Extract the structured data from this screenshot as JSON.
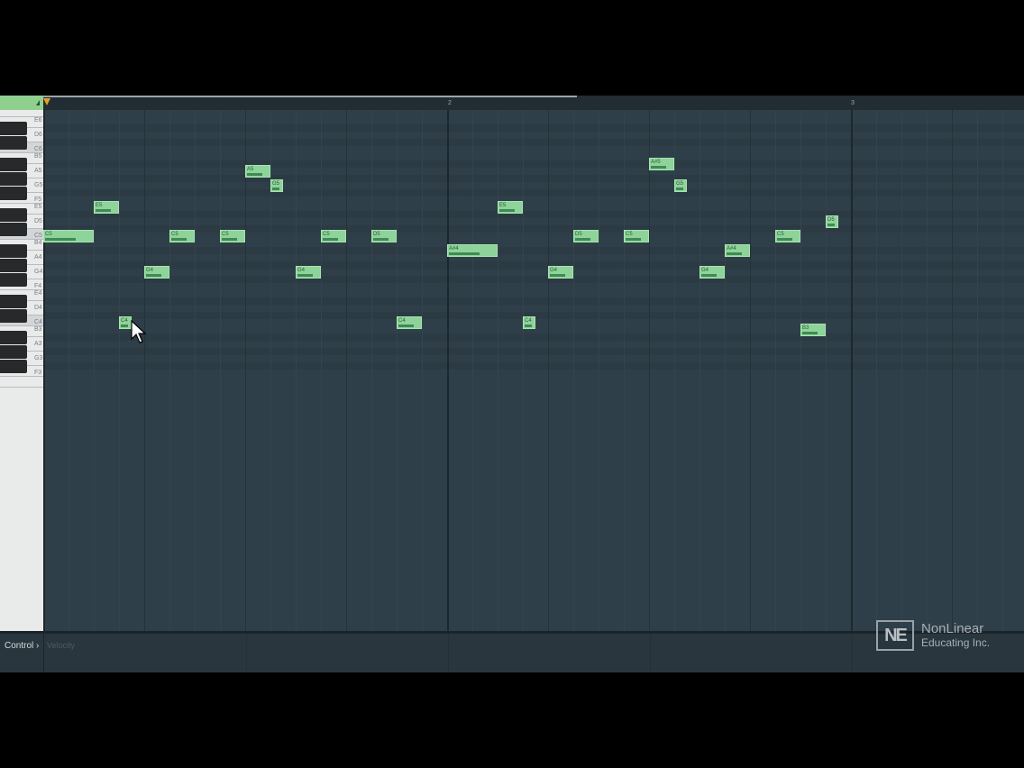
{
  "app": {
    "ruler_bars": [
      "2",
      "3"
    ],
    "accent_color": "#8ed39a",
    "playhead_color": "#e2a12a"
  },
  "keyboard": {
    "labels": [
      "E6",
      "D6",
      "C6",
      "B5",
      "A5",
      "G5",
      "F5",
      "E5",
      "D5",
      "C5",
      "B4",
      "A4",
      "G4",
      "F4",
      "E4",
      "D4",
      "C4",
      "B3",
      "A3",
      "G3",
      "F3"
    ]
  },
  "notes": [
    {
      "label": "C5"
    },
    {
      "label": "E5"
    },
    {
      "label": "C4"
    },
    {
      "label": "G4"
    },
    {
      "label": "C5"
    },
    {
      "label": "C5"
    },
    {
      "label": "A5"
    },
    {
      "label": "G5"
    },
    {
      "label": "G4"
    },
    {
      "label": "C5"
    },
    {
      "label": "D5"
    },
    {
      "label": "C4"
    },
    {
      "label": "A#4"
    },
    {
      "label": "E5"
    },
    {
      "label": "C4"
    },
    {
      "label": "G4"
    },
    {
      "label": "D5"
    },
    {
      "label": "C5"
    },
    {
      "label": "A#5"
    },
    {
      "label": "G5"
    },
    {
      "label": "G4"
    },
    {
      "label": "A#4"
    },
    {
      "label": "C5"
    },
    {
      "label": "B3"
    },
    {
      "label": "D5"
    }
  ],
  "control": {
    "label": "Control",
    "chevron": "›",
    "sub": "Velocity"
  },
  "watermark": {
    "mark": "NE",
    "line1": "NonLinear",
    "line2": "Educating Inc."
  }
}
